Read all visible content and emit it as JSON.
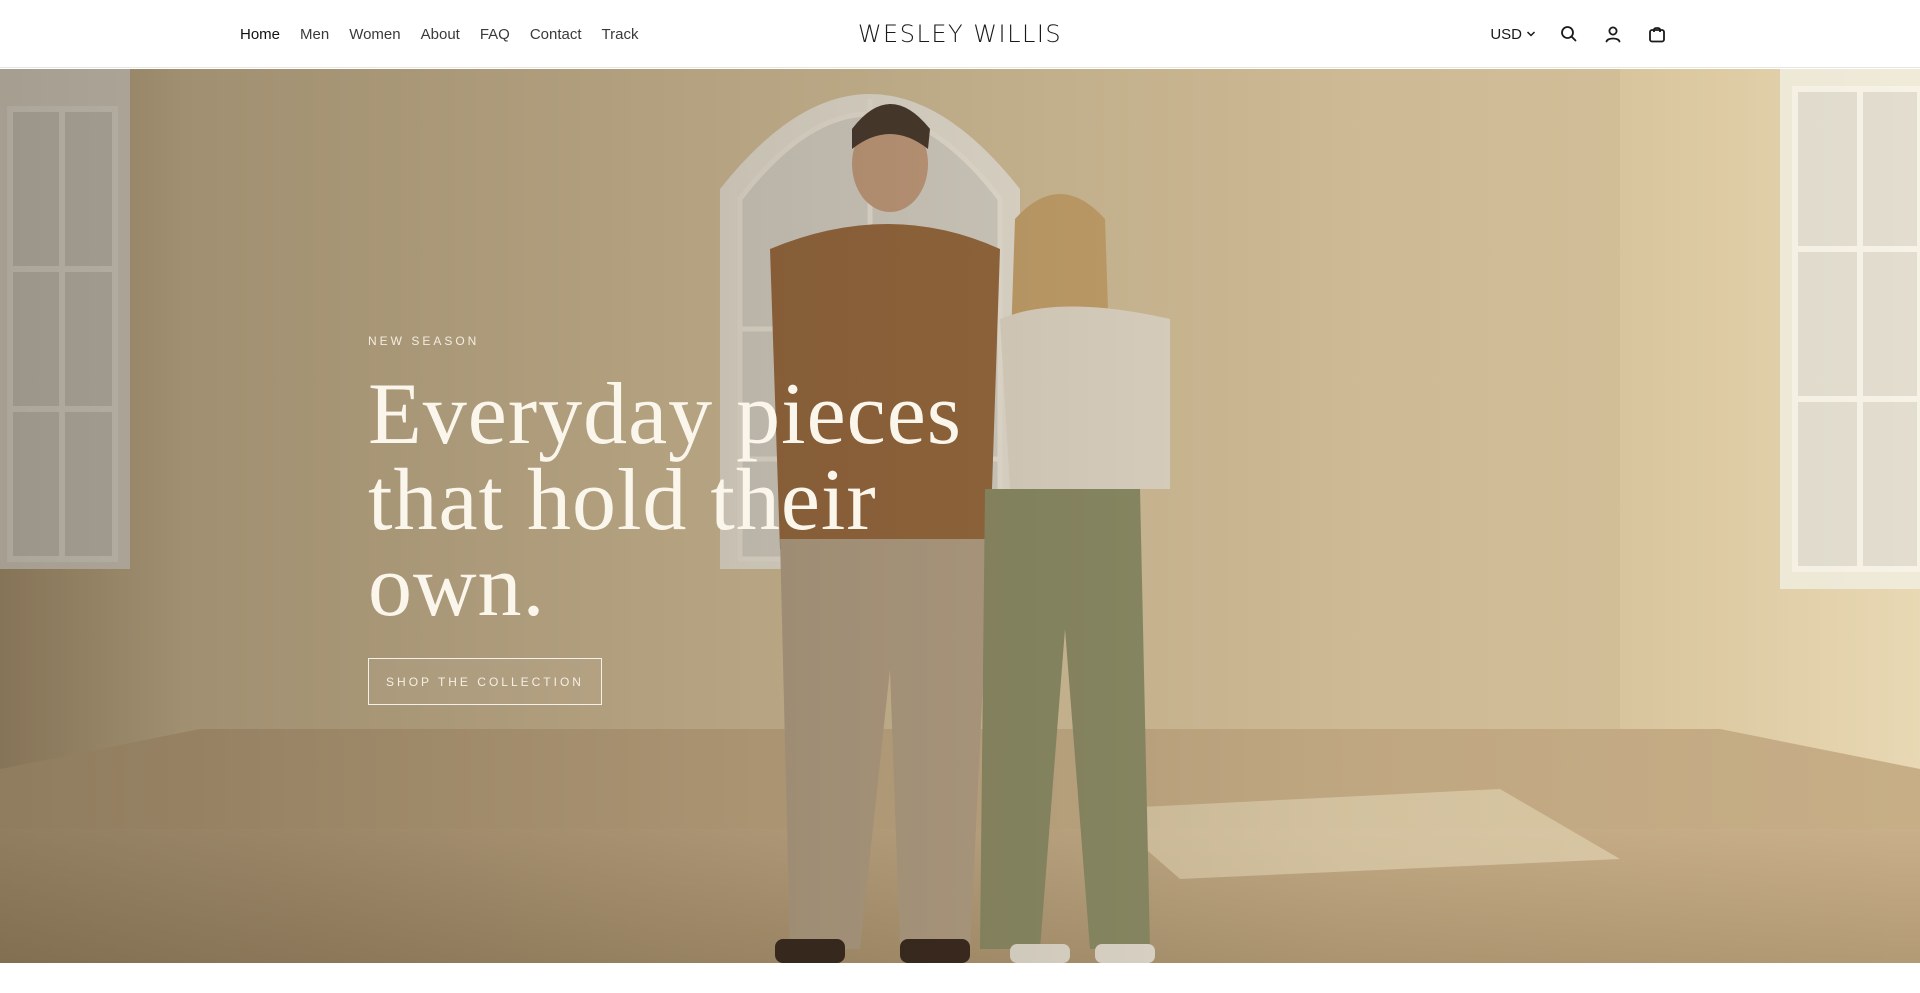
{
  "header": {
    "nav": [
      {
        "label": "Home"
      },
      {
        "label": "Men"
      },
      {
        "label": "Women"
      },
      {
        "label": "About"
      },
      {
        "label": "FAQ"
      },
      {
        "label": "Contact"
      },
      {
        "label": "Track"
      }
    ],
    "brand": "WESLEY WILLIS",
    "currency": "USD",
    "icons": {
      "currency": "chevron-down-icon",
      "search": "search-icon",
      "account": "user-icon",
      "cart": "bag-icon"
    }
  },
  "hero": {
    "eyebrow": "NEW SEASON",
    "headline_lines": [
      "Everyday pieces",
      "that hold their",
      "own."
    ],
    "cta_label": "SHOP THE COLLECTION"
  },
  "colors": {
    "header_bg": "#ffffff",
    "hero_text": "#fbf6ec",
    "wall": "#d7c39b"
  }
}
